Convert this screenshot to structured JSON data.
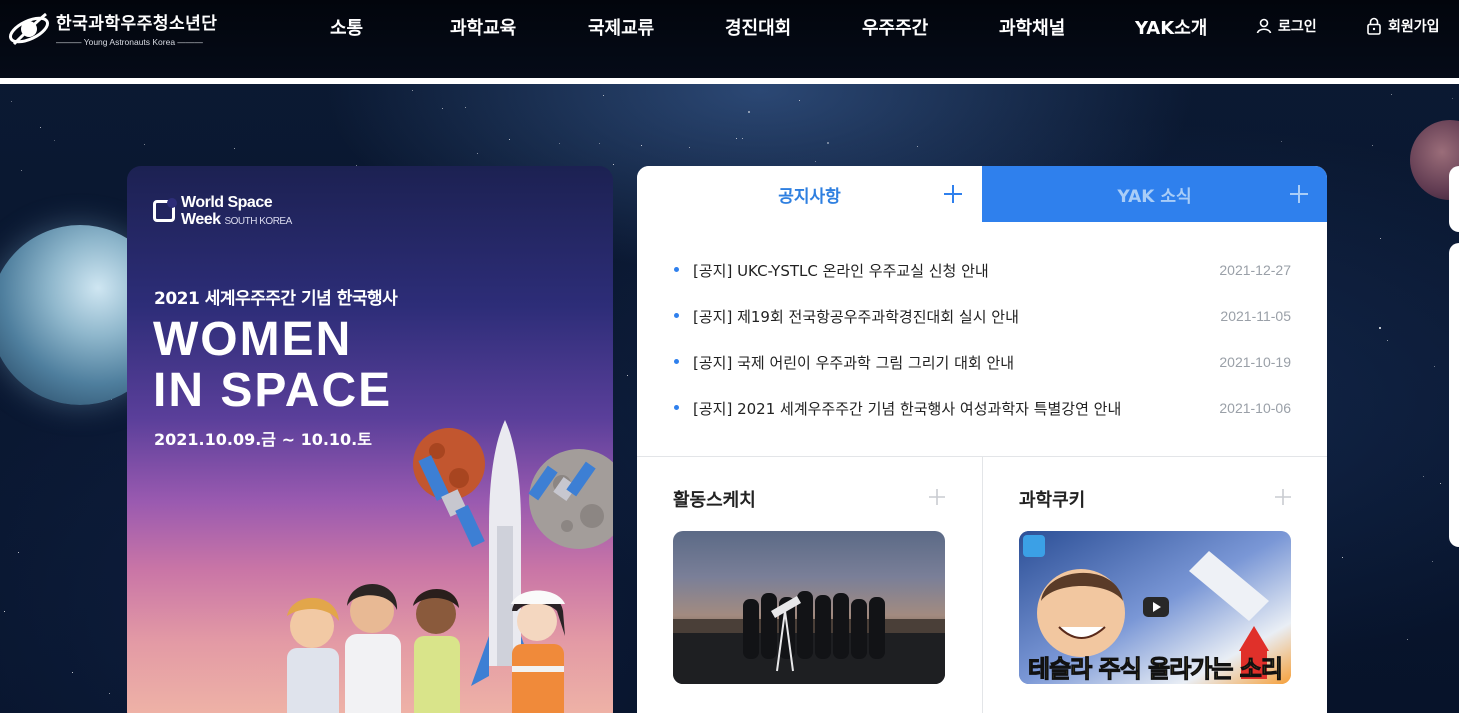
{
  "header": {
    "logo_name": "한국과학우주청소년단",
    "logo_sub": "——— Young Astronauts Korea ———",
    "nav": [
      "소통",
      "과학교육",
      "국제교류",
      "경진대회",
      "우주주간",
      "과학채널",
      "YAK소개"
    ],
    "login_label": "로그인",
    "signup_label": "회원가입"
  },
  "poster": {
    "logo_line1": "World Space",
    "logo_line2": "Week",
    "logo_sub": "SOUTH KOREA",
    "subtitle": "2021 세계우주주간 기념 한국행사",
    "title": "WOMEN\nIN SPACE",
    "date": "2021.10.09.금 ~ 10.10.토"
  },
  "panel": {
    "tabs": [
      {
        "label": "공지사항",
        "active": true
      },
      {
        "label": "YAK 소식",
        "active": false
      }
    ],
    "notices": [
      {
        "title": "[공지] UKC-YSTLC 온라인 우주교실 신청 안내",
        "date": "2021-12-27"
      },
      {
        "title": "[공지] 제19회 전국항공우주과학경진대회 실시 안내",
        "date": "2021-11-05"
      },
      {
        "title": "[공지] 국제 어린이 우주과학 그림 그리기 대회 안내",
        "date": "2021-10-19"
      },
      {
        "title": "[공지] 2021 세계우주주간 기념 한국행사 여성과학자 특별강연 안내",
        "date": "2021-10-06"
      }
    ],
    "sketch_title": "활동스케치",
    "cookie_title": "과학쿠키",
    "cookie_caption": "테슬라 주식 올라가는 소리"
  },
  "colors": {
    "accent": "#2f80ed",
    "accent_text": "#2e7fe0",
    "inactive_tab_text": "#a9cdf7"
  },
  "icons": {
    "login": "person-icon",
    "signup": "lock-icon",
    "more": "plus-icon",
    "play": "play-icon"
  }
}
